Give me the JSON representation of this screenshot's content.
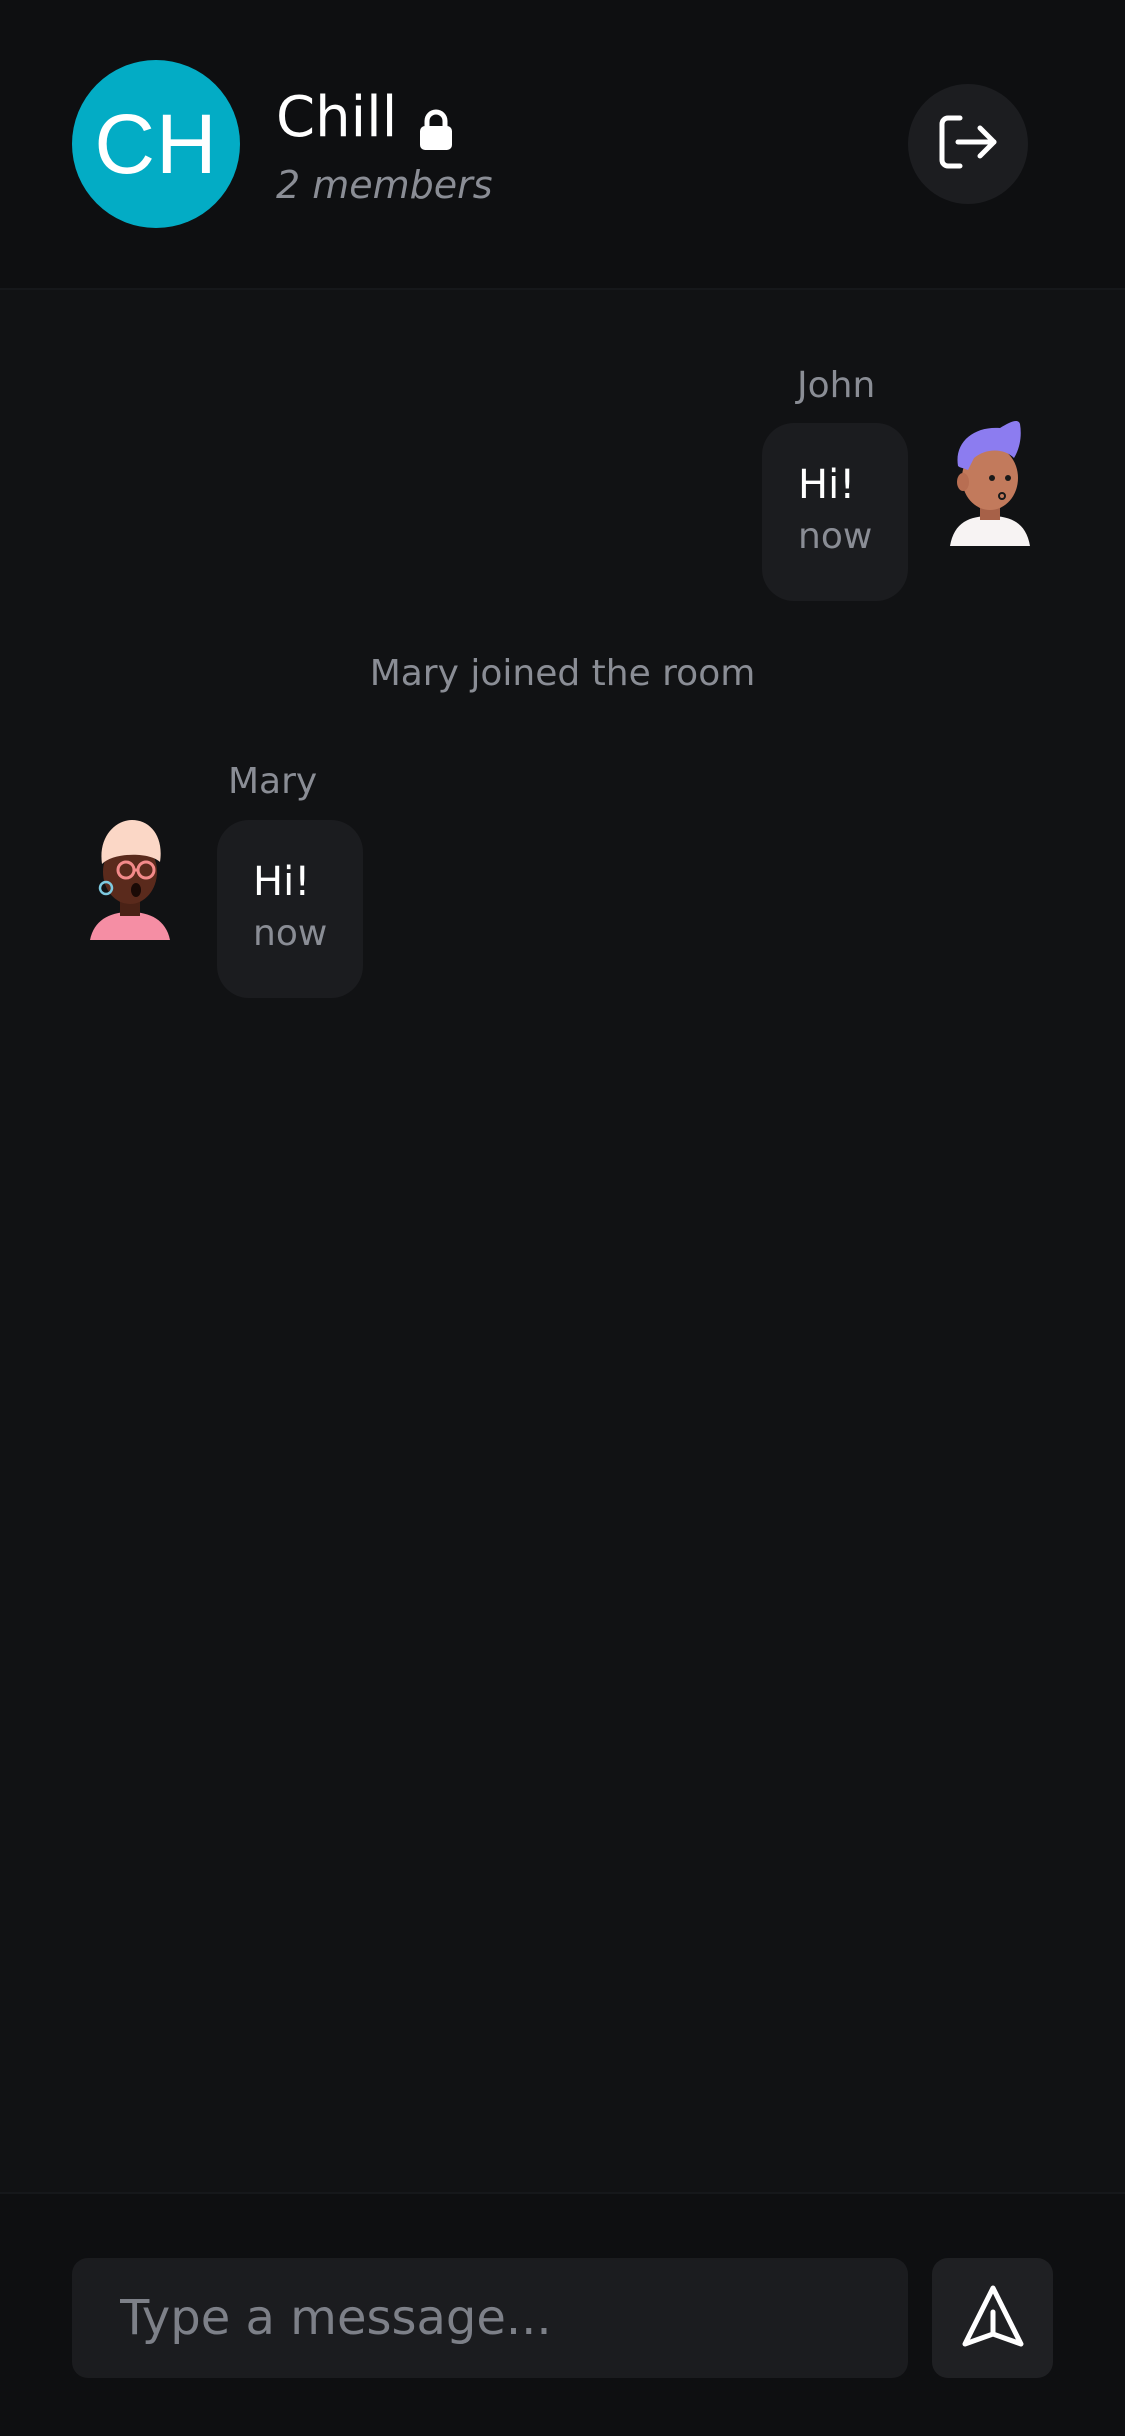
{
  "header": {
    "avatar_initials": "CH",
    "avatar_color": "#03acc5",
    "room_name": "Chill",
    "room_locked_icon": "lock-icon",
    "members_text": "2 members",
    "leave_icon": "sign-out-icon"
  },
  "messages": [
    {
      "sender": "John",
      "text": "Hi!",
      "time": "now",
      "side": "right",
      "avatar": "john-avatar"
    },
    {
      "sender": "Mary",
      "text": "Hi!",
      "time": "now",
      "side": "left",
      "avatar": "mary-avatar"
    }
  ],
  "system_messages": [
    {
      "text": "Mary joined the room"
    }
  ],
  "composer": {
    "placeholder": "Type a message...",
    "send_icon": "send-icon"
  }
}
